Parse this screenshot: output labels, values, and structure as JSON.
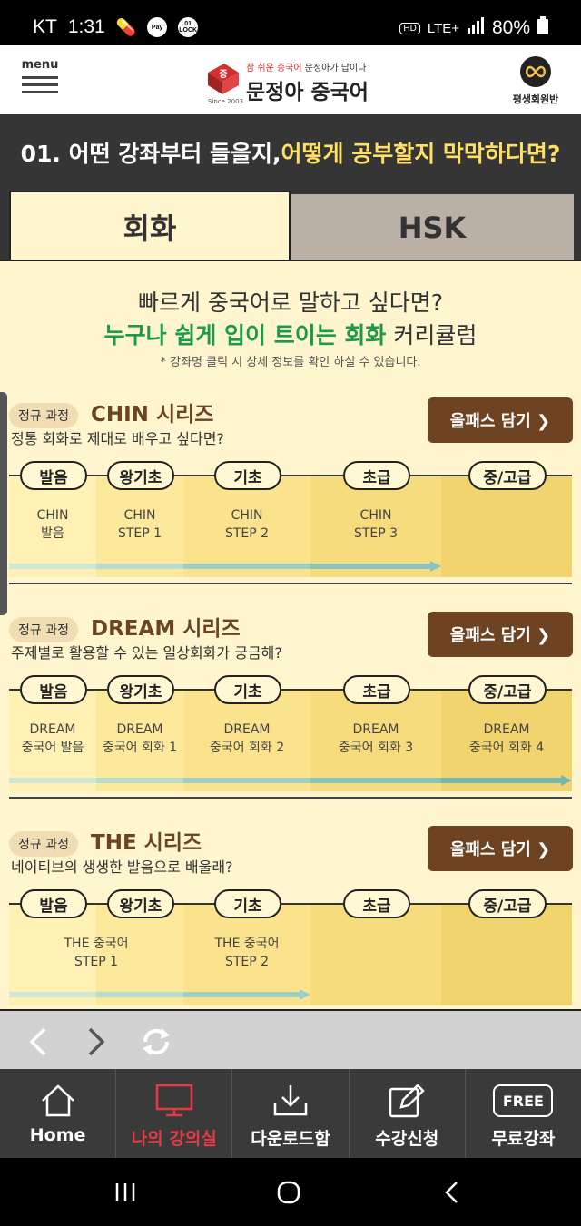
{
  "status": {
    "carrier": "KT",
    "time": "1:31",
    "pay_chip": "Pay",
    "lock_chip": "01 LOCK",
    "hd": "HD",
    "lte": "LTE+",
    "battery": "80%"
  },
  "header": {
    "menu_label": "menu",
    "logo_tagline_red": "참 쉬운 중국어",
    "logo_tagline": "문정아가 답이다",
    "logo_name": "문정아 중국어",
    "logo_since": "Since 2003",
    "lifetime_label": "평생회원반"
  },
  "banner": {
    "prefix": "01. 어떤 강좌부터 들을지, ",
    "highlight": "어떻게 공부할지 막막하다면?"
  },
  "tabs": [
    {
      "label": "회화"
    },
    {
      "label": "HSK"
    }
  ],
  "intro": {
    "line1": "빠르게 중국어로 말하고 싶다면?",
    "line2_green": "누구나 쉽게 입이 트이는 회화",
    "line2_rest": " 커리큘럼",
    "note": "* 강좌명 클릭 시 상세 정보를 확인 하실 수 있습니다."
  },
  "levels": [
    "발음",
    "왕기초",
    "기초",
    "초급",
    "중/고급"
  ],
  "series": [
    {
      "badge": "정규 과정",
      "title": "CHIN 시리즈",
      "desc": "정통 회화로 제대로 배우고 싶다면?",
      "button": "올패스 담기 ❯",
      "courses": [
        {
          "line1": "CHIN",
          "line2": "발음"
        },
        {
          "line1": "CHIN",
          "line2": "STEP 1"
        },
        {
          "line1": "CHIN",
          "line2": "STEP 2"
        },
        {
          "line1": "CHIN",
          "line2": "STEP 3"
        }
      ]
    },
    {
      "badge": "정규 과정",
      "title": "DREAM 시리즈",
      "desc": "주제별로 활용할 수 있는 일상회화가 궁금해?",
      "button": "올패스 담기 ❯",
      "courses": [
        {
          "line1": "DREAM",
          "line2": "중국어 발음"
        },
        {
          "line1": "DREAM",
          "line2": "중국어 회화 1"
        },
        {
          "line1": "DREAM",
          "line2": "중국어 회화 2"
        },
        {
          "line1": "DREAM",
          "line2": "중국어 회화 3"
        },
        {
          "line1": "DREAM",
          "line2": "중국어 회화 4"
        }
      ]
    },
    {
      "badge": "정규 과정",
      "title": "THE 시리즈",
      "desc": "네이티브의 생생한 발음으로 배울래?",
      "button": "올패스 담기 ❯",
      "courses": [
        {
          "line1": "THE 중국어",
          "line2": "STEP 1"
        },
        {
          "line1": "THE 중국어",
          "line2": "STEP 2"
        }
      ]
    }
  ],
  "tabbar": [
    {
      "label": "Home"
    },
    {
      "label": "나의 강의실"
    },
    {
      "label": "다운로드함"
    },
    {
      "label": "수강신청"
    },
    {
      "label": "무료강좌",
      "icon_text": "FREE"
    }
  ],
  "colors": {
    "accent_red": "#e63946",
    "green": "#1a9b4b",
    "brown": "#6e4322",
    "banner_bg": "#353535"
  }
}
